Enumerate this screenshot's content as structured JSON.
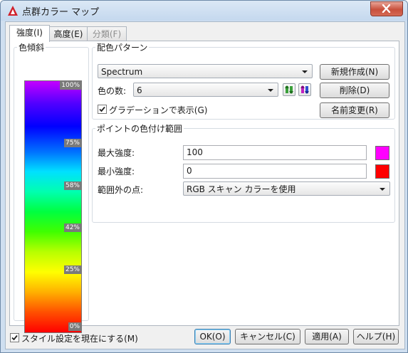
{
  "window": {
    "title": "点群カラー マップ"
  },
  "tabs": [
    {
      "label": "強度(I)"
    },
    {
      "label": "高度(E)"
    },
    {
      "label": "分類(F)"
    }
  ],
  "gradient": {
    "label": "色傾斜",
    "ticks": [
      "100%",
      "75%",
      "58%",
      "42%",
      "25%",
      "0%"
    ]
  },
  "scheme": {
    "label": "配色パターン",
    "selected": "Spectrum",
    "color_count_label": "色の数:",
    "color_count_value": "6",
    "gradation_label": "グラデーションで表示(G)",
    "gradation_checked": true,
    "new_button": "新規作成(N)",
    "delete_button": "削除(D)",
    "rename_button": "名前変更(R)"
  },
  "range": {
    "label": "ポイントの色付け範囲",
    "max_label": "最大強度:",
    "max_value": "100",
    "max_color": "#ff00ff",
    "min_label": "最小強度:",
    "min_value": "0",
    "min_color": "#ff0000",
    "outside_label": "範囲外の点:",
    "outside_value": "RGB スキャン カラーを使用"
  },
  "footer": {
    "style_checkbox_label": "スタイル設定を現在にする(M)",
    "style_checked": true,
    "ok": "OK(O)",
    "cancel": "キャンセル(C)",
    "apply": "適用(A)",
    "help": "ヘルプ(H)"
  }
}
